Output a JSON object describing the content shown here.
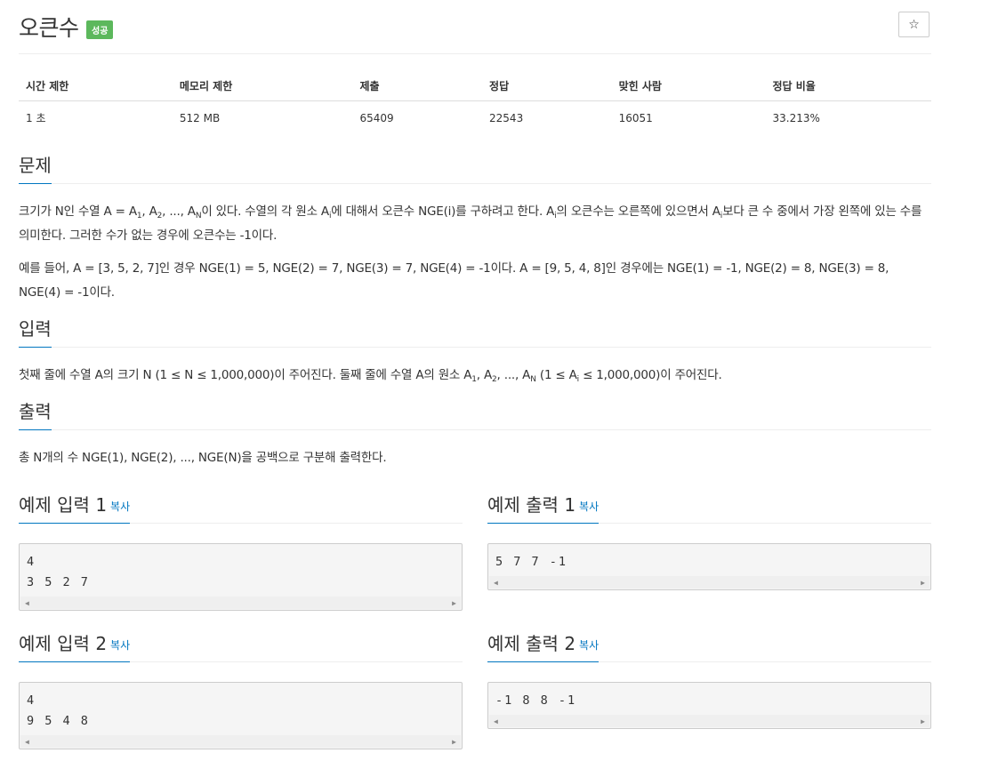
{
  "problem": {
    "title": "오큰수",
    "badge": "성공",
    "star": "☆"
  },
  "info_table": {
    "headers": [
      "시간 제한",
      "메모리 제한",
      "제출",
      "정답",
      "맞힌 사람",
      "정답 비율"
    ],
    "values": [
      "1 초",
      "512 MB",
      "65409",
      "22543",
      "16051",
      "33.213%"
    ]
  },
  "sections": {
    "description": "문제",
    "input": "입력",
    "output": "출력"
  },
  "samples": {
    "copy_label": "복사",
    "input1_title": "예제 입력 1",
    "output1_title": "예제 출력 1",
    "input2_title": "예제 입력 2",
    "output2_title": "예제 출력 2",
    "input1": "4\n3 5 2 7",
    "output1": "5 7 7 -1",
    "input2": "4\n9 5 4 8",
    "output2": "-1 8 8 -1"
  },
  "colors": {
    "badge": "#5cb85c",
    "link": "#0076C0"
  }
}
